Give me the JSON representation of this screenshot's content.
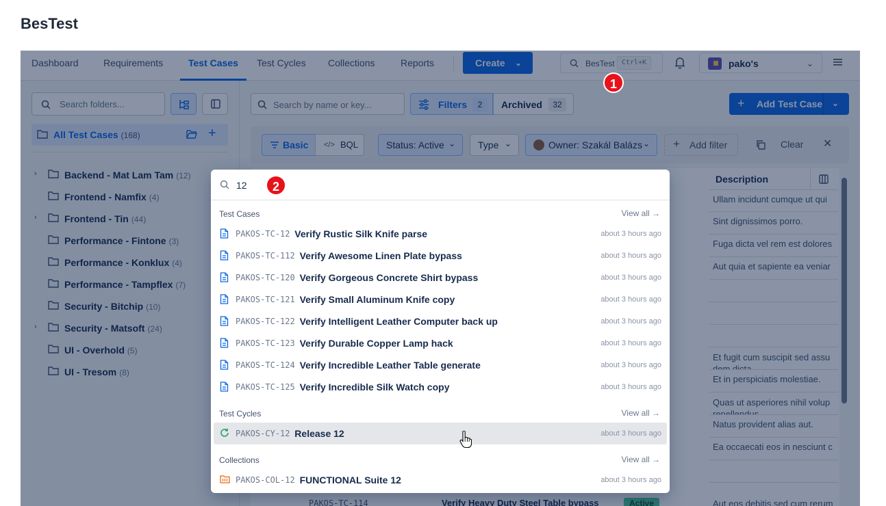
{
  "page_title": "BesTest",
  "nav": {
    "tabs": [
      {
        "label": "Dashboard"
      },
      {
        "label": "Requirements"
      },
      {
        "label": "Test Cases"
      },
      {
        "label": "Test Cycles"
      },
      {
        "label": "Collections"
      },
      {
        "label": "Reports"
      }
    ],
    "create_label": "Create",
    "search_label": "BesTest",
    "search_shortcut": "Ctrl+K",
    "workspace_name": "pako's"
  },
  "annotations": [
    "1",
    "2"
  ],
  "sidebar": {
    "search_placeholder": "Search folders...",
    "all_label": "All Test Cases",
    "all_count": "(168)",
    "folders": [
      {
        "name": "Backend - Mat Lam Tam",
        "count": "(12)"
      },
      {
        "name": "Frontend - Namfix",
        "count": "(4)"
      },
      {
        "name": "Frontend - Tin",
        "count": "(44)"
      },
      {
        "name": "Performance - Fintone",
        "count": "(3)"
      },
      {
        "name": "Performance - Konklux",
        "count": "(4)"
      },
      {
        "name": "Performance - Tampflex",
        "count": "(7)"
      },
      {
        "name": "Security - Bitchip",
        "count": "(10)"
      },
      {
        "name": "Security - Matsoft",
        "count": "(24)"
      },
      {
        "name": "UI - Overhold",
        "count": "(5)"
      },
      {
        "name": "UI - Tresom",
        "count": "(8)"
      }
    ]
  },
  "toolbar": {
    "search_placeholder": "Search by name or key...",
    "filters_label": "Filters",
    "filters_count": "2",
    "archived_label": "Archived",
    "archived_count": "32",
    "add_label": "Add Test Case"
  },
  "filterbar": {
    "basic": "Basic",
    "bql": "BQL",
    "status": "Status: Active",
    "type": "Type",
    "owner": "Owner: Szakál Balázs",
    "add_filter": "Add filter",
    "clear": "Clear"
  },
  "table": {
    "desc_header": "Description",
    "descriptions": [
      "Ullam incidunt cumque ut qui",
      "Sint dignissimos porro.",
      "Fuga dicta vel rem est dolores",
      "Aut quia et sapiente ea veniar",
      "",
      "",
      "",
      "Et fugit cum suscipit sed assu dem dicta.",
      "Et in perspiciatis molestiae.",
      "Quas ut asperiores nihil volup repellendus.",
      "Natus provident alias aut.",
      "Ea occaecati eos in nesciunt c",
      ""
    ],
    "bottom_key": "PAKOS-TC-114",
    "bottom_title": "Verify Heavy Duty Steel Table bypass",
    "bottom_status": "Active",
    "bottom_desc": "Aut eos debitis sed cum rerum"
  },
  "popup": {
    "query": "12",
    "view_all": "View all",
    "sections": [
      {
        "header": "Test Cases",
        "items": [
          {
            "key": "PAKOS-TC-12",
            "title": "Verify Rustic Silk Knife parse",
            "time": "about 3 hours ago"
          },
          {
            "key": "PAKOS-TC-112",
            "title": "Verify Awesome Linen Plate bypass",
            "time": "about 3 hours ago"
          },
          {
            "key": "PAKOS-TC-120",
            "title": "Verify Gorgeous Concrete Shirt bypass",
            "time": "about 3 hours ago"
          },
          {
            "key": "PAKOS-TC-121",
            "title": "Verify Small Aluminum Knife copy",
            "time": "about 3 hours ago"
          },
          {
            "key": "PAKOS-TC-122",
            "title": "Verify Intelligent Leather Computer back up",
            "time": "about 3 hours ago"
          },
          {
            "key": "PAKOS-TC-123",
            "title": "Verify Durable Copper Lamp hack",
            "time": "about 3 hours ago"
          },
          {
            "key": "PAKOS-TC-124",
            "title": "Verify Incredible Leather Table generate",
            "time": "about 3 hours ago"
          },
          {
            "key": "PAKOS-TC-125",
            "title": "Verify Incredible Silk Watch copy",
            "time": "about 3 hours ago"
          }
        ]
      },
      {
        "header": "Test Cycles",
        "items": [
          {
            "key": "PAKOS-CY-12",
            "title": "Release 12",
            "time": "about 3 hours ago"
          }
        ]
      },
      {
        "header": "Collections",
        "items": [
          {
            "key": "PAKOS-COL-12",
            "title": "FUNCTIONAL Suite 12",
            "time": "about 3 hours ago"
          }
        ]
      }
    ]
  },
  "colors": {
    "primary": "#0c66e4",
    "badge_red": "#e8121b",
    "cycle_green": "#22a06b",
    "collection_orange": "#e56910"
  }
}
